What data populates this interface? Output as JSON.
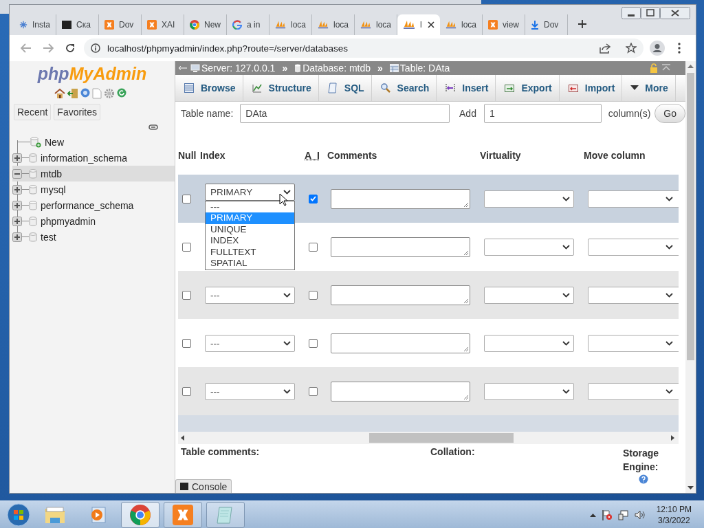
{
  "browser": {
    "tabs": [
      {
        "kind": "spark",
        "label": "Insta",
        "selected": false
      },
      {
        "kind": "terminal",
        "label": "Ска",
        "selected": false
      },
      {
        "kind": "xampp",
        "label": "Dov",
        "selected": false
      },
      {
        "kind": "xampp",
        "label": "XAI",
        "selected": false
      },
      {
        "kind": "chrome",
        "label": "New",
        "selected": false
      },
      {
        "kind": "google",
        "label": "a in",
        "selected": false
      },
      {
        "kind": "pma",
        "label": "loca",
        "selected": false
      },
      {
        "kind": "pma",
        "label": "loca",
        "selected": false
      },
      {
        "kind": "pma",
        "label": "loca",
        "selected": false
      },
      {
        "kind": "pma",
        "label": "l",
        "selected": true
      },
      {
        "kind": "pma",
        "label": "loca",
        "selected": false
      },
      {
        "kind": "xampp",
        "label": "view",
        "selected": false
      },
      {
        "kind": "download",
        "label": "Dov",
        "selected": false
      }
    ],
    "address": "localhost/phpmyadmin/index.php?route=/server/databases"
  },
  "sidebar": {
    "logo": {
      "part_1": "php",
      "part_2": "MyAdmin"
    },
    "buttons": [
      "Recent",
      "Favorites"
    ],
    "tree": [
      {
        "kind": "new",
        "label": "New",
        "selected": false
      },
      {
        "kind": "database",
        "label": "information_schema",
        "expanded": false,
        "selected": false
      },
      {
        "kind": "database",
        "label": "mtdb",
        "expanded": true,
        "selected": true
      },
      {
        "kind": "database",
        "label": "mysql",
        "expanded": false,
        "selected": false
      },
      {
        "kind": "database",
        "label": "performance_schema",
        "expanded": false,
        "selected": false
      },
      {
        "kind": "database",
        "label": "phpmyadmin",
        "expanded": false,
        "selected": false
      },
      {
        "kind": "database",
        "label": "test",
        "expanded": false,
        "selected": false
      }
    ]
  },
  "breadcrumb": [
    {
      "kind": "server",
      "label": "Server: 127.0.0.1"
    },
    {
      "kind": "separator",
      "label": "»"
    },
    {
      "kind": "database",
      "label": "Database: mtdb"
    },
    {
      "kind": "separator",
      "label": "»"
    },
    {
      "kind": "table",
      "label": "Table: DAta"
    }
  ],
  "menu": [
    {
      "kind": "browse",
      "label": "Browse"
    },
    {
      "kind": "structure",
      "label": "Structure"
    },
    {
      "kind": "sql",
      "label": "SQL"
    },
    {
      "kind": "search",
      "label": "Search"
    },
    {
      "kind": "insert",
      "label": "Insert"
    },
    {
      "kind": "export",
      "label": "Export"
    },
    {
      "kind": "import",
      "label": "Import"
    },
    {
      "kind": "more",
      "label": "More"
    }
  ],
  "table_form": {
    "table_name_label": "Table name:",
    "table_name": "DAta",
    "add_label": "Add",
    "add_count": "1",
    "columns_label": "column(s)",
    "go": "Go"
  },
  "columns": [
    "Null",
    "Index",
    "A_I",
    "Comments",
    "Virtuality",
    "Move column"
  ],
  "rows": [
    {
      "null": false,
      "index": "PRIMARY",
      "ai": true,
      "highlighted": true,
      "dropdown": {
        "options": [
          {
            "label": "---",
            "selected": false
          },
          {
            "label": "PRIMARY",
            "selected": true
          },
          {
            "label": "UNIQUE",
            "selected": false
          },
          {
            "label": "INDEX",
            "selected": false
          },
          {
            "label": "FULLTEXT",
            "selected": false
          },
          {
            "label": "SPATIAL",
            "selected": false
          }
        ]
      }
    },
    {
      "null": false,
      "ai": false,
      "highlighted": false
    },
    {
      "null": false,
      "index": "---",
      "ai": false,
      "highlighted": false
    },
    {
      "null": false,
      "index": "---",
      "ai": false,
      "highlighted": false
    },
    {
      "null": false,
      "index": "---",
      "ai": false,
      "highlighted": false
    }
  ],
  "footer": {
    "table_comments": "Table comments:",
    "collation": "Collation:",
    "storage_engine": "Storage Engine:"
  },
  "console": "Console",
  "taskbar": {
    "apps": [
      {
        "kind": "explorer",
        "running": false,
        "active": false
      },
      {
        "kind": "media",
        "running": false,
        "active": false
      },
      {
        "kind": "chrome",
        "running": true,
        "active": true
      },
      {
        "kind": "xampp",
        "running": true,
        "active": false
      },
      {
        "kind": "notepad",
        "running": true,
        "active": false
      }
    ],
    "time": "12:10 PM",
    "date": "3/3/2022"
  }
}
